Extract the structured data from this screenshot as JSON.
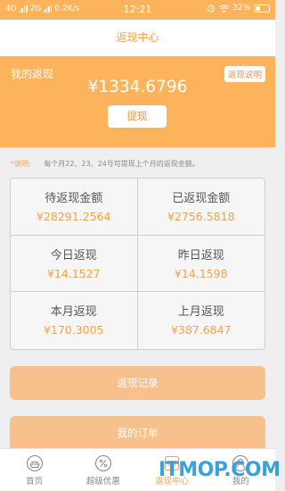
{
  "status_bar": {
    "network_left": "4G",
    "network_right": "2G",
    "speed": "0.2K/s",
    "time": "12:21",
    "battery": "32%"
  },
  "nav": {
    "title": "返现中心"
  },
  "hero": {
    "title": "我的返现",
    "help_label": "返现说明",
    "amount": "¥1334.6796",
    "withdraw_label": "提现"
  },
  "note": {
    "label": "*说明:",
    "text": "每个月22、23、24号可提现上个月的返现金额。"
  },
  "stats": [
    {
      "label": "待返现金额",
      "value": "¥28291.2564"
    },
    {
      "label": "已返现金额",
      "value": "¥2756.5818"
    },
    {
      "label": "今日返现",
      "value": "¥14.1527"
    },
    {
      "label": "昨日返现",
      "value": "¥14.1598"
    },
    {
      "label": "本月返现",
      "value": "¥170.3005"
    },
    {
      "label": "上月返现",
      "value": "¥387.6847"
    }
  ],
  "actions": {
    "records_label": "返现记录",
    "orders_label": "我的订单"
  },
  "tabs": [
    {
      "label": "首页",
      "icon": "home-icon"
    },
    {
      "label": "超级优惠",
      "icon": "discount-icon"
    },
    {
      "label": "返现中心",
      "icon": "cashback-icon",
      "active": true
    },
    {
      "label": "我的",
      "icon": "user-icon"
    }
  ],
  "watermark": "ITMOP.COM",
  "colors": {
    "accent": "#fdb35c",
    "accent_text": "#f5a04a",
    "button_light": "#f8c08c"
  }
}
